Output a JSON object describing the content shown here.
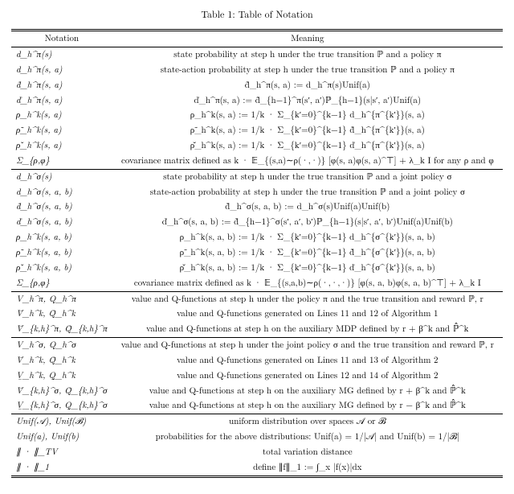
{
  "caption": "Table 1: Table of Notation",
  "header": {
    "left": "Notation",
    "right": "Meaning"
  },
  "sections": [
    {
      "rows": [
        {
          "n": "d_h^π(s)",
          "m": "state probability at step h under the true transition ℙ and a policy π"
        },
        {
          "n": "d_h^π(s, a)",
          "m": "state-action probability at step h under the true transition ℙ and a policy π"
        },
        {
          "n": "d̃_h^π(s, a)",
          "m": "d̃_h^π(s, a) := d_h^π(s)Unif(a)"
        },
        {
          "n": "ď_h^π(s, a)",
          "m": "ď_h^π(s, a) := d̃_{h−1}^π(s′, a′)ℙ_{h−1}(s|s′, a′)Unif(a)"
        },
        {
          "n": "ρ_h^k(s, a)",
          "m": "ρ_h^k(s, a) := 1/k · Σ_{k′=0}^{k−1} d_h^{π^{k′}}(s, a)"
        },
        {
          "n": "ρ̃_h^k(s, a)",
          "m": "ρ̃_h^k(s, a) := 1/k · Σ_{k′=0}^{k−1} d̃_h^{π^{k′}}(s, a)"
        },
        {
          "n": "ρ̌_h^k(s, a)",
          "m": "ρ̌_h^k(s, a) := 1/k · Σ_{k′=0}^{k−1} ď_h^{π^{k′}}(s, a)"
        },
        {
          "n": "Σ_{ρ,φ}",
          "m": "covariance matrix defined as k · 𝔼_{(s,a)∼ρ(·,·)} [φ(s, a)φ(s, a)^⊤] + λ_k I for any ρ and φ"
        }
      ]
    },
    {
      "rows": [
        {
          "n": "d_h^σ(s)",
          "m": "state probability at step h under the true transition ℙ and a joint policy σ"
        },
        {
          "n": "d_h^σ(s, a, b)",
          "m": "state-action probability at step h under the true transition ℙ and a joint policy σ"
        },
        {
          "n": "d̃_h^σ(s, a, b)",
          "m": "d̃_h^σ(s, a, b) := d_h^σ(s)Unif(a)Unif(b)"
        },
        {
          "n": "ď_h^σ(s, a, b)",
          "m": "ď_h^σ(s, a, b) := d̃_{h−1}^σ(s′, a′, b′)ℙ_{h−1}(s|s′, a′, b′)Unif(a)Unif(b)"
        },
        {
          "n": "ρ_h^k(s, a, b)",
          "m": "ρ_h^k(s, a, b) := 1/k · Σ_{k′=0}^{k−1} d_h^{σ^{k′}}(s, a, b)"
        },
        {
          "n": "ρ̃_h^k(s, a, b)",
          "m": "ρ̃_h^k(s, a, b) := 1/k · Σ_{k′=0}^{k−1} d̃_h^{σ^{k′}}(s, a, b)"
        },
        {
          "n": "ρ̌_h^k(s, a, b)",
          "m": "ρ̌_h^k(s, a, b) := 1/k · Σ_{k′=0}^{k−1} ď_h^{σ^{k′}}(s, a, b)"
        },
        {
          "n": "Σ_{ρ,φ}",
          "m": "covariance matrix defined as k · 𝔼_{(s,a,b)∼ρ(·,·,·)} [φ(s, a, b)φ(s, a, b)^⊤] + λ_k I"
        }
      ]
    },
    {
      "rows": [
        {
          "n": "V_h^π, Q_h^π",
          "m": "value and Q-functions at step h under the policy π and the true transition and reward ℙ, r"
        },
        {
          "n": "V̄_h^k, Q̄_h^k",
          "m": "value and Q-functions generated on Lines 11 and 12 of Algorithm 1"
        },
        {
          "n": "V̄_{k,h}^π, Q̄_{k,h}^π",
          "m": "value and Q-functions at step h on the auxiliary MDP defined by r + β^k and ℙ̂^k"
        }
      ]
    },
    {
      "rows": [
        {
          "n": "V_h^σ, Q_h^σ",
          "m": "value and Q-functions at step h under the joint policy σ and the true transition and reward ℙ, r"
        },
        {
          "n": "V̄_h^k, Q̄_h^k",
          "m": "value and Q-functions generated on Lines 11 and 13 of Algorithm 2"
        },
        {
          "n": "V̲_h^k, Q̲_h^k",
          "m": "value and Q-functions generated on Lines 12 and 14 of Algorithm 2"
        },
        {
          "n": "V̄_{k,h}^σ, Q̄_{k,h}^σ",
          "m": "value and Q-functions at step h on the auxiliary MG defined by r + β^k and ℙ̂^k"
        },
        {
          "n": "V̲_{k,h}^σ, Q̲_{k,h}^σ",
          "m": "value and Q-functions at step h on the auxiliary MG defined by r − β^k and ℙ̂^k"
        }
      ]
    },
    {
      "rows": [
        {
          "n": "Unif(𝒜), Unif(ℬ)",
          "m": "uniform distribution over spaces 𝒜 or ℬ"
        },
        {
          "n": "Unif(a), Unif(b)",
          "m": "probabilities for the above distributions: Unif(a) = 1/|𝒜| and Unif(b) = 1/|ℬ|"
        },
        {
          "n": "∥ · ∥_TV",
          "m": "total variation distance"
        },
        {
          "n": "∥ · ∥_1",
          "m": "define ∥f∥_1 := ∫_x |f(x)|dx"
        }
      ]
    }
  ]
}
